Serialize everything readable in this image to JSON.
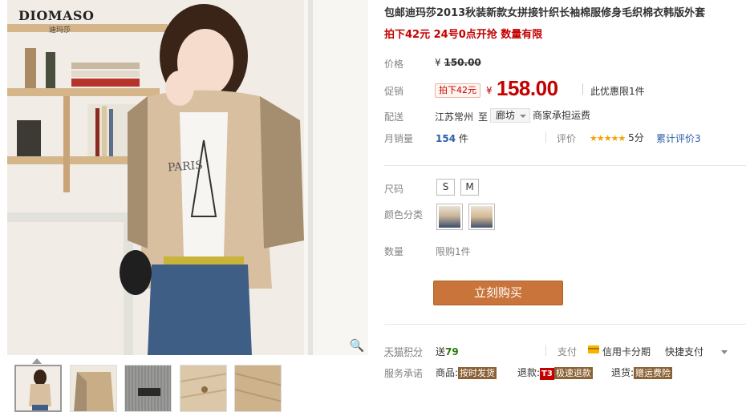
{
  "gallery": {
    "brand": "DIOMASO",
    "brand_cn": "迪玛莎",
    "image_caption": "PARIS",
    "zoom_icon": "magnifier-icon"
  },
  "product": {
    "title": "包邮迪玛莎2013秋装新款女拼接针织长袖棉服修身毛织棉衣韩版外套",
    "subtitle": "拍下42元 24号0点开抢 数量有限"
  },
  "price": {
    "label": "价格",
    "yen": "¥",
    "original": "150.00",
    "promo_label": "促销",
    "promo_tag": "拍下42元",
    "current": "158.00",
    "limit": "此优惠限1件"
  },
  "shipping": {
    "label": "配送",
    "from": "江苏常州",
    "to_word": "至",
    "destination": "廊坊",
    "fee_note": "商家承担运费"
  },
  "sales": {
    "label": "月销量",
    "count": "154",
    "unit": "件",
    "rating_label": "评价",
    "stars": "★★★★★",
    "score": "5分",
    "reviews": "累计评价3"
  },
  "sku": {
    "size_label": "尺码",
    "sizes": [
      "S",
      "M"
    ],
    "color_label": "颜色分类",
    "quantity_label": "数量",
    "quantity_limit": "限购1件"
  },
  "actions": {
    "buy_now": "立刻购买"
  },
  "footer": {
    "points_label": "天猫积分",
    "points_prefix": "送",
    "points_value": "79",
    "pay_label": "支付",
    "card_installment": "信用卡分期",
    "quick_pay": "快捷支付",
    "service_label": "服务承诺",
    "goods_label": "商品:",
    "goods_badge": "按时发货",
    "refund_label": "退款:",
    "refund_t3": "T3",
    "refund_badge": "极速退款",
    "return_label": "退货:",
    "return_badge": "赠运费险"
  },
  "colors": {
    "accent_red": "#c40000",
    "buy_button": "#c8743a",
    "link_blue": "#2b5fa8"
  }
}
